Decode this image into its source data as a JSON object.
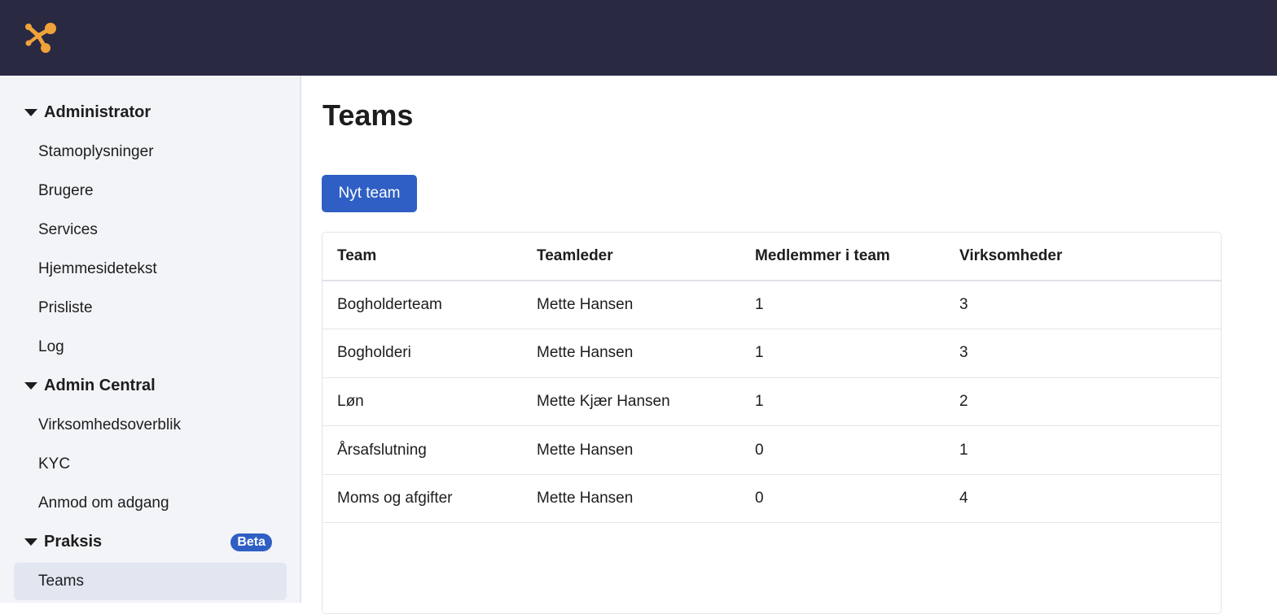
{
  "colors": {
    "topbar": "#2a2942",
    "logo": "#f0a33a",
    "primary": "#2f5fc4",
    "sidebar_bg": "#f3f4f8",
    "active_item_bg": "#e2e6f1"
  },
  "header": {
    "logo_icon": "logo-icon"
  },
  "sidebar": {
    "sections": [
      {
        "title": "Administrator",
        "items": [
          "Stamoplysninger",
          "Brugere",
          "Services",
          "Hjemmesidetekst",
          "Prisliste",
          "Log"
        ]
      },
      {
        "title": "Admin Central",
        "items": [
          "Virksomhedsoverblik",
          "KYC",
          "Anmod om adgang"
        ]
      },
      {
        "title": "Praksis",
        "badge": "Beta",
        "items": [
          "Teams"
        ],
        "active_item": "Teams"
      }
    ]
  },
  "main": {
    "title": "Teams",
    "new_button_label": "Nyt team",
    "table": {
      "headers": [
        "Team",
        "Teamleder",
        "Medlemmer i team",
        "Virksomheder"
      ],
      "rows": [
        [
          "Bogholderteam",
          "Mette Hansen",
          "1",
          "3"
        ],
        [
          "Bogholderi",
          "Mette Hansen",
          "1",
          "3"
        ],
        [
          "Løn",
          "Mette Kjær Hansen",
          "1",
          "2"
        ],
        [
          "Årsafslutning",
          "Mette Hansen",
          "0",
          "1"
        ],
        [
          "Moms og afgifter",
          "Mette Hansen",
          "0",
          "4"
        ]
      ]
    }
  }
}
